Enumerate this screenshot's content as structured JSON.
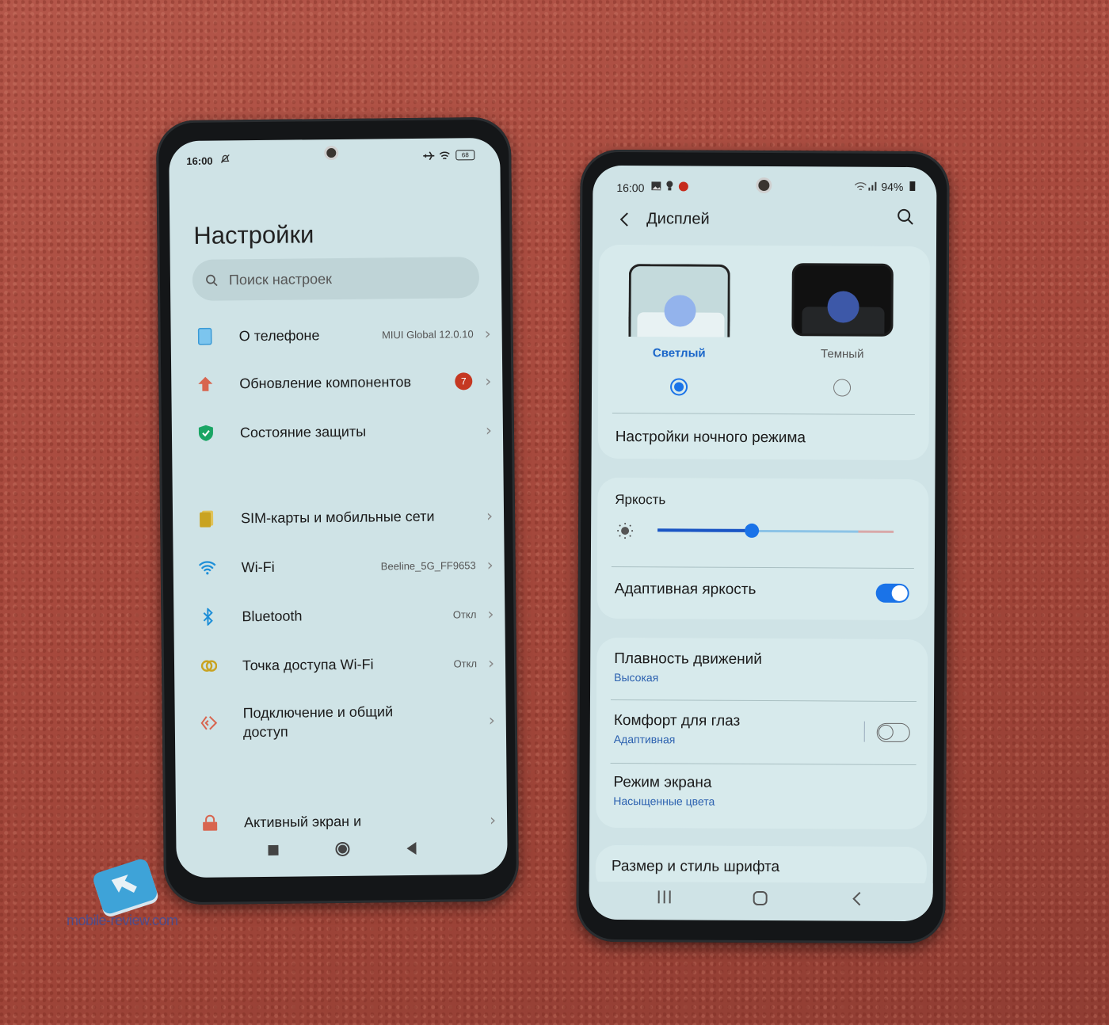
{
  "left_phone": {
    "status_bar": {
      "time": "16:00",
      "icons": [
        "bell-off-icon",
        "airplane-icon",
        "wifi-icon"
      ],
      "battery": "68"
    },
    "title": "Настройки",
    "search": {
      "placeholder": "Поиск настроек"
    },
    "items": [
      {
        "label": "О телефоне",
        "value": "MIUI Global 12.0.10",
        "icon": "phone-info-icon",
        "color": "#62b8e6"
      },
      {
        "label": "Обновление компонентов",
        "badge": "7",
        "icon": "update-arrow-icon",
        "color": "#d8654f"
      },
      {
        "label": "Состояние защиты",
        "icon": "shield-check-icon",
        "color": "#1aa564"
      },
      {
        "label": "SIM-карты и мобильные сети",
        "icon": "sim-card-icon",
        "color": "#c9a321"
      },
      {
        "label": "Wi-Fi",
        "value": "Beeline_5G_FF9653",
        "icon": "wifi-icon",
        "color": "#1e8fd8"
      },
      {
        "label": "Bluetooth",
        "value": "Откл",
        "icon": "bluetooth-icon",
        "color": "#1e8fd8"
      },
      {
        "label": "Точка доступа Wi-Fi",
        "value": "Откл",
        "icon": "hotspot-icon",
        "color": "#c9a321"
      },
      {
        "label": "Подключение и общий доступ",
        "icon": "connection-share-icon",
        "color": "#d8654f"
      },
      {
        "label": "Активный экран и",
        "icon": "lock-icon",
        "color": "#d8654f"
      }
    ],
    "nav": [
      "recents-square-icon",
      "home-circle-icon",
      "back-triangle-icon"
    ]
  },
  "right_phone": {
    "status_bar": {
      "time": "16:00",
      "icons": [
        "gallery-icon",
        "bulb-icon",
        "app-notification-icon",
        "wifi-icon",
        "signal-icon"
      ],
      "battery": "94%"
    },
    "header": {
      "title": "Дисплей",
      "back": "back-chevron-icon",
      "search": "search-icon"
    },
    "theme": {
      "options": [
        {
          "label": "Светлый",
          "selected": true
        },
        {
          "label": "Темный",
          "selected": false
        }
      ],
      "accent": "#1a73e8"
    },
    "night_mode_settings": "Настройки ночного режима",
    "brightness": {
      "label": "Яркость",
      "value_fraction": 0.4
    },
    "adaptive_brightness": {
      "label": "Адаптивная яркость",
      "on": true
    },
    "motion_smoothness": {
      "label": "Плавность движений",
      "value": "Высокая"
    },
    "eye_comfort": {
      "label": "Комфорт для глаз",
      "value": "Адаптивная",
      "on": false
    },
    "screen_mode": {
      "label": "Режим экрана",
      "value": "Насыщенные цвета"
    },
    "font_size": {
      "label": "Размер и стиль шрифта"
    },
    "nav": [
      "recents-lines-icon",
      "home-square-icon",
      "back-chevron-icon"
    ]
  },
  "watermark": "mobile-review.com"
}
